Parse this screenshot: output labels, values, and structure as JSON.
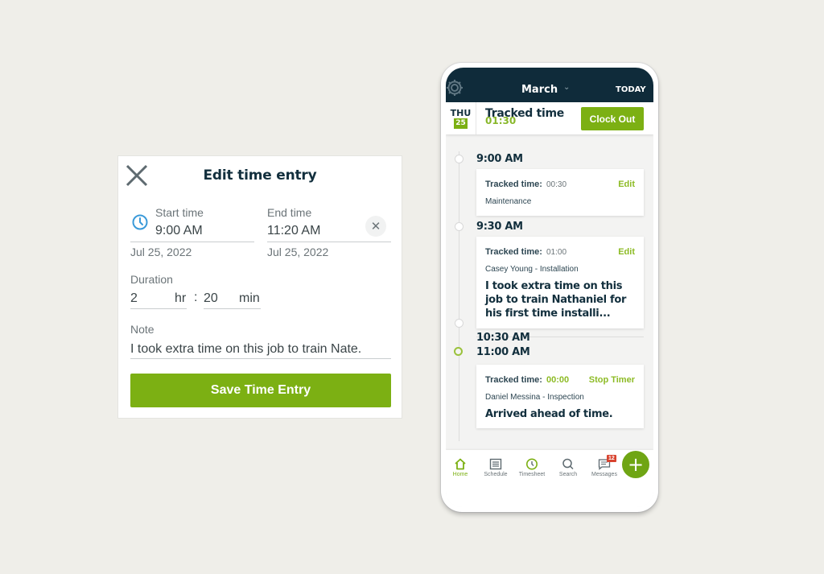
{
  "dialog": {
    "title": "Edit time entry",
    "start_time": {
      "label": "Start time",
      "value": "9:00 AM",
      "date": "Jul 25, 2022"
    },
    "end_time": {
      "label": "End time",
      "value": "11:20 AM",
      "date": "Jul 25, 2022"
    },
    "duration": {
      "label": "Duration",
      "hours": "2",
      "hours_unit": "hr",
      "separator": ":",
      "minutes": "20",
      "minutes_unit": "min"
    },
    "note": {
      "label": "Note",
      "value": "I took extra time on this job to train Nate."
    },
    "save_label": "Save Time Entry",
    "icons": {
      "close": "close-x-icon",
      "clock": "clock-icon",
      "clear": "clear-x-icon"
    }
  },
  "phone": {
    "header": {
      "month": "March",
      "today_label": "TODAY",
      "settings_icon": "gear-icon",
      "dropdown_icon": "chevron-down-icon"
    },
    "datebar": {
      "day_of_week": "THU",
      "day_number": "25",
      "tracked_title": "Tracked time",
      "tracked_value": "01:30",
      "clock_out_label": "Clock Out"
    },
    "timeline": [
      {
        "time": "9:00 AM",
        "card": {
          "tracked_label": "Tracked time:",
          "tracked_value": "00:30",
          "action": "Edit",
          "subtitle": "Maintenance",
          "note": ""
        }
      },
      {
        "time": "9:30 AM",
        "card": {
          "tracked_label": "Tracked time:",
          "tracked_value": "01:00",
          "action": "Edit",
          "subtitle": "Casey Young - Installation",
          "note": "I took extra time on this job to train Nathaniel for his first time installi..."
        }
      },
      {
        "time": "10:30 AM"
      },
      {
        "time": "11:00 AM",
        "card": {
          "tracked_label": "Tracked time:",
          "tracked_value": "00:00",
          "action": "Stop Timer",
          "subtitle": "Daniel Messina - Inspection",
          "note": "Arrived ahead of time."
        }
      }
    ],
    "bottom_nav": [
      {
        "label": "Home",
        "icon": "home-icon",
        "active": true
      },
      {
        "label": "Schedule",
        "icon": "schedule-list-icon",
        "active": false
      },
      {
        "label": "Timesheet",
        "icon": "clock-icon",
        "active": false
      },
      {
        "label": "Search",
        "icon": "search-icon",
        "active": false
      },
      {
        "label": "Messages",
        "icon": "message-icon",
        "active": false,
        "badge": "12"
      }
    ],
    "fab_label": "+",
    "colors": {
      "brand_green": "#7cb013",
      "navy": "#0f2b3a",
      "badge_red": "#d8432f"
    }
  }
}
